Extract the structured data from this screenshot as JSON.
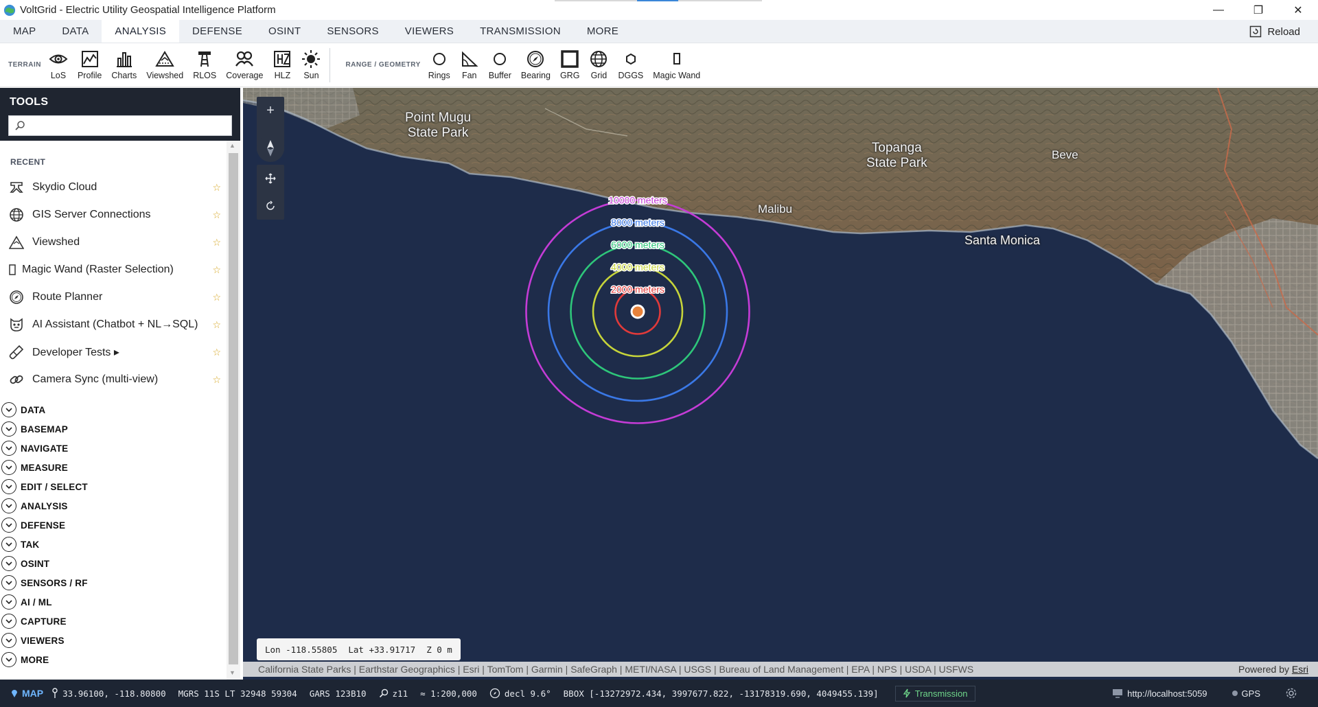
{
  "window": {
    "title": "VoltGrid - Electric Utility Geospatial Intelligence Platform",
    "minimize": "—",
    "restore": "❐",
    "close": "✕"
  },
  "menu": {
    "tabs": [
      "MAP",
      "DATA",
      "ANALYSIS",
      "DEFENSE",
      "OSINT",
      "SENSORS",
      "VIEWERS",
      "TRANSMISSION",
      "MORE"
    ],
    "active": "ANALYSIS",
    "reload_label": "Reload"
  },
  "ribbon": {
    "terrain_label": "TERRAIN",
    "terrain_tools": [
      "LoS",
      "Profile",
      "Charts",
      "Viewshed",
      "RLOS",
      "Coverage",
      "HLZ",
      "Sun"
    ],
    "range_label": "RANGE / GEOMETRY",
    "range_tools": [
      "Rings",
      "Fan",
      "Buffer",
      "Bearing",
      "GRG",
      "Grid",
      "DGGS",
      "Magic Wand"
    ]
  },
  "sidebar": {
    "title": "TOOLS",
    "search_placeholder": "",
    "recent_label": "RECENT",
    "recent": [
      {
        "label": "Skydio Cloud",
        "icon": "drone-icon"
      },
      {
        "label": "GIS Server Connections",
        "icon": "globe-icon"
      },
      {
        "label": "Viewshed",
        "icon": "viewshed-icon"
      },
      {
        "label": "Magic Wand (Raster Selection)",
        "icon": "magic-wand-icon"
      },
      {
        "label": "Route Planner",
        "icon": "compass-icon"
      },
      {
        "label": "AI Assistant (Chatbot + NL→SQL)",
        "icon": "robot-icon"
      },
      {
        "label": "Developer Tests ▸",
        "icon": "test-tube-icon"
      },
      {
        "label": "Camera Sync (multi-view)",
        "icon": "link-icon"
      }
    ],
    "categories": [
      "DATA",
      "BASEMAP",
      "NAVIGATE",
      "MEASURE",
      "EDIT / SELECT",
      "ANALYSIS",
      "DEFENSE",
      "TAK",
      "OSINT",
      "SENSORS / RF",
      "AI / ML",
      "CAPTURE",
      "VIEWERS",
      "MORE"
    ]
  },
  "map": {
    "rings": [
      {
        "label": "10000 meters",
        "color": "#c43cd6",
        "radius_m": 10000
      },
      {
        "label": "8000 meters",
        "color": "#3a78e6",
        "radius_m": 8000
      },
      {
        "label": "6000 meters",
        "color": "#2ec67a",
        "radius_m": 6000
      },
      {
        "label": "4000 meters",
        "color": "#c6d43a",
        "radius_m": 4000
      },
      {
        "label": "2000 meters",
        "color": "#e03a3a",
        "radius_m": 2000
      }
    ],
    "center_color": "#e8823a",
    "places": [
      "Point Mugu\nState Park",
      "Topanga\nState Park",
      "Malibu",
      "Santa Monica",
      "Beve"
    ],
    "coords": {
      "lon": "Lon -118.55805",
      "lat": "Lat +33.91717",
      "z": "Z 0 m"
    },
    "attribution": "California State Parks | Earthstar Geographics | Esri | TomTom | Garmin | SafeGraph | METI/NASA | USGS | Bureau of Land Management | EPA | NPS | USDA | USFWS",
    "powered_prefix": "Powered by ",
    "powered_link": "Esri",
    "zoom_in": "+",
    "zoom_out": "—"
  },
  "status": {
    "mode": "MAP",
    "latlon": "33.96100, -118.80800",
    "mgrs": "MGRS 11S LT 32948 59304",
    "gars": "GARS 123B10",
    "zoom": "z11",
    "scale": "≈ 1:200,000",
    "decl": "decl 9.6°",
    "bbox": "BBOX [-13272972.434, 3997677.822, -13178319.690, 4049455.139]",
    "transmission": "Transmission",
    "server": "http://localhost:5059",
    "gps": "GPS"
  }
}
